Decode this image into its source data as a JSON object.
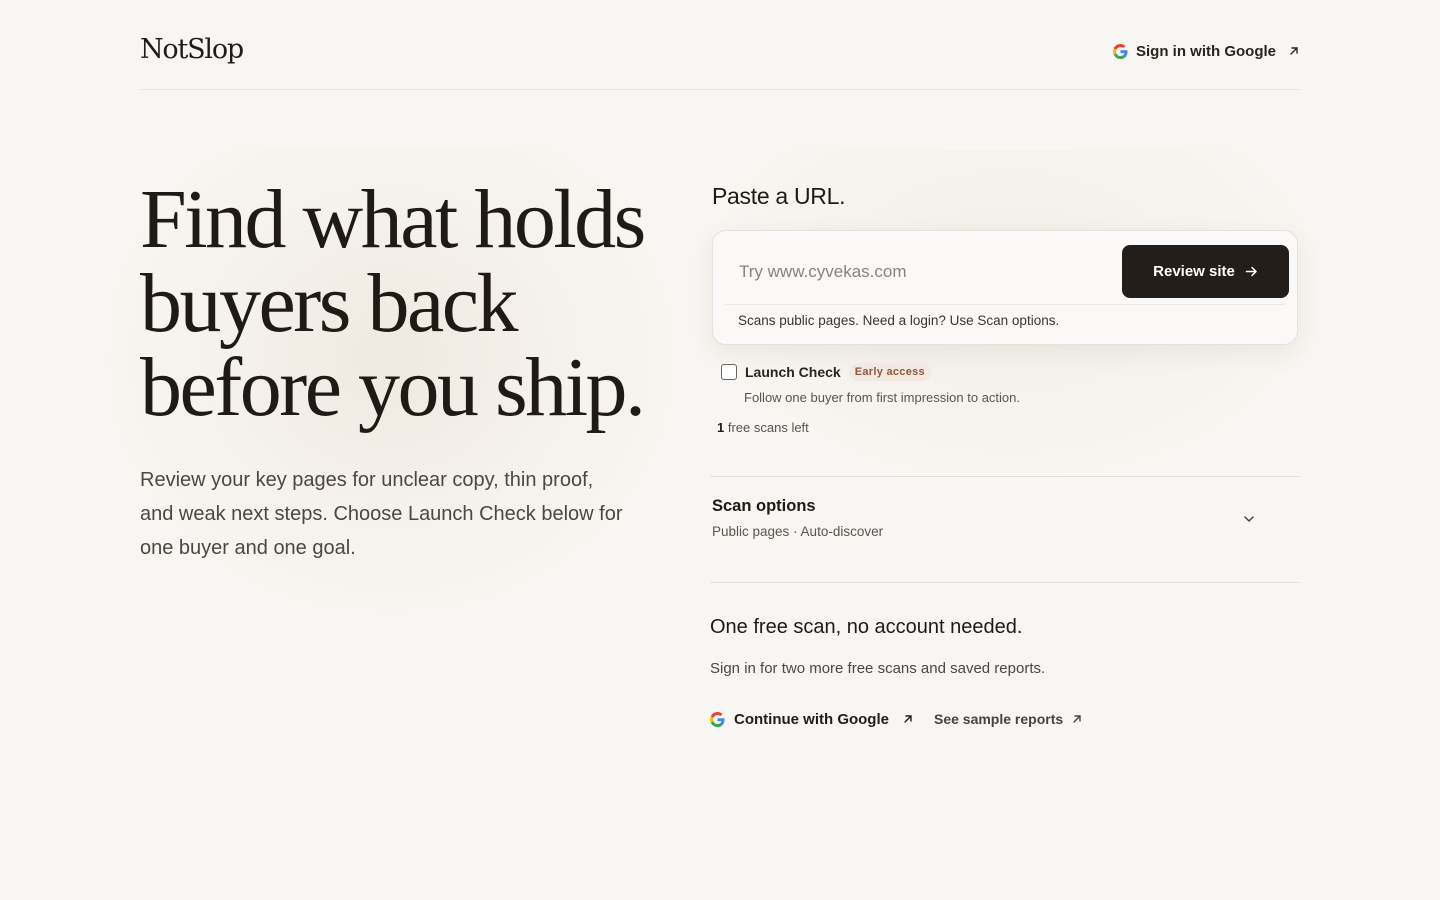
{
  "header": {
    "logo": "NotSlop",
    "signin_label": "Sign in with Google"
  },
  "hero": {
    "title": "Find what holds buyers back before you ship.",
    "subtitle": "Review your key pages for unclear copy, thin proof, and weak next steps. Choose Launch Check below for one buyer and one goal."
  },
  "url_form": {
    "heading": "Paste a URL.",
    "placeholder": "Try www.cyvekas.com",
    "value": "",
    "button_label": "Review site",
    "note": "Scans public pages. Need a login? Use Scan options."
  },
  "launch_check": {
    "label": "Launch Check",
    "badge": "Early access",
    "checked": false,
    "description": "Follow one buyer from first impression to action."
  },
  "free_scans": {
    "count": "1",
    "text": "free scans left"
  },
  "scan_options": {
    "title": "Scan options",
    "summary": "Public pages · Auto-discover"
  },
  "signup": {
    "heading": "One free scan, no account needed.",
    "subtext": "Sign in for two more free scans and saved reports.",
    "google_label": "Continue with Google",
    "sample_label": "See sample reports"
  },
  "icons": {
    "google": "google-icon",
    "external": "arrow-up-right-icon",
    "arrow": "arrow-right-icon",
    "chevron": "chevron-down-icon"
  },
  "colors": {
    "background": "#f8f6f2",
    "primary_button": "#231e1a",
    "badge_text": "#8a5a3c",
    "badge_bg": "#f1e9e2"
  }
}
